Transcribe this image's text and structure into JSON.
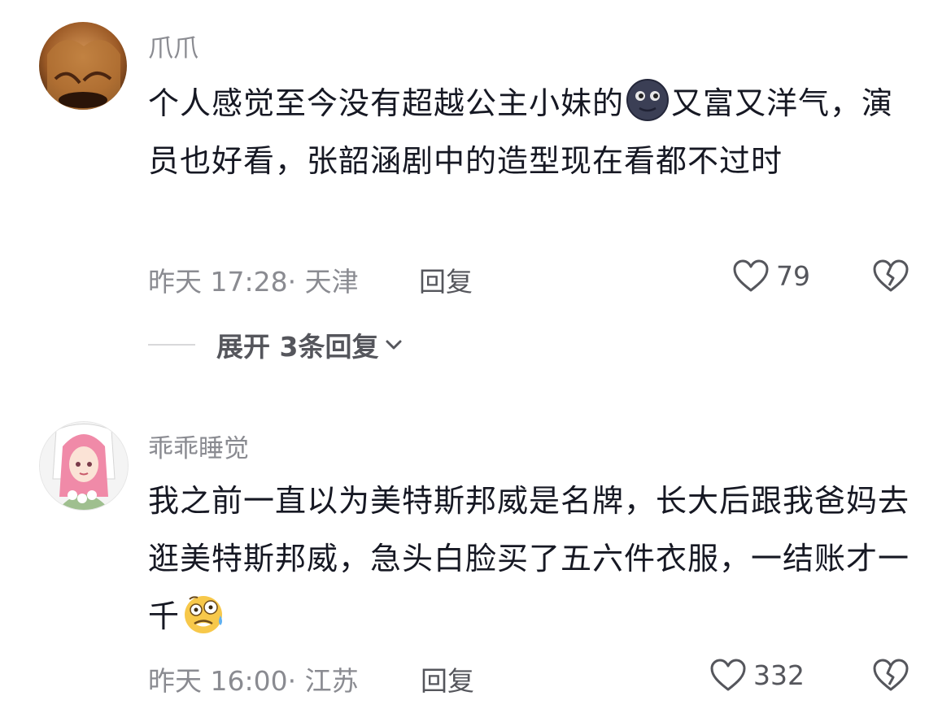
{
  "comments": [
    {
      "username": "爪爪",
      "content_parts": [
        "个人感觉至今没有超越公主小妹的",
        "又富又洋气，演员也好看，张韶涵剧中的造型现在看都不过时"
      ],
      "emoji": "new-moon-face-emoji",
      "time_location": "昨天 17:28· 天津",
      "reply_label": "回复",
      "like_count": "79",
      "expand_replies": "展开 3条回复"
    },
    {
      "username": "乖乖睡觉",
      "content_parts": [
        "我之前一直以为美特斯邦威是名牌，长大后跟我爸妈去逛美特斯邦威，急头白脸买了五六件衣服，一结账才一千",
        ""
      ],
      "emoji": "woozy-sweat-face-emoji",
      "time_location": "昨天 16:00· 江苏",
      "reply_label": "回复",
      "like_count": "332"
    }
  ],
  "colors": {
    "primary_text": "#161823",
    "secondary_text": "#8a8b91",
    "action_text": "#55565c"
  }
}
